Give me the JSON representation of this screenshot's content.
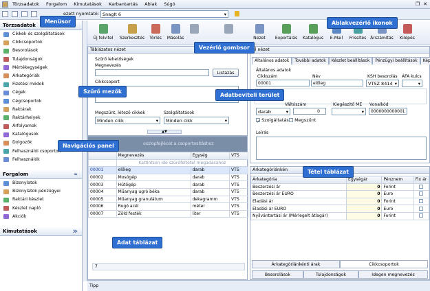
{
  "menu": [
    "Törzsadatok",
    "Forgalom",
    "Kimutatások",
    "Karbantartás",
    "Ablak",
    "Súgó"
  ],
  "printer": {
    "label": "ezett nyomtató:",
    "value": "SnagIt 6"
  },
  "sidebar": {
    "section1": "Törzsadatok",
    "items1": [
      "Cikkek és szolgáltatások",
      "Cikkcsoportok",
      "Besorolások",
      "Tulajdonságok",
      "Mértékegységek",
      "Árkategóriák",
      "Fizetési módok",
      "Cégek",
      "Cégcsoportok",
      "Raktárak",
      "Raktárhelyek",
      "Árfolyamok",
      "Katalógusok",
      "Dolgozók",
      "Felhasználói csoportok",
      "Felhasználók"
    ],
    "section2": "Forgalom",
    "items2": [
      "Bizonylatok",
      "Bizonylatok pénzügyei",
      "Raktári készlet",
      "Készlet napló",
      "Akciók"
    ],
    "section3": "Kimutatások"
  },
  "toolbar": [
    "Új felvitel",
    "Szerkesztés",
    "Törlés",
    "Másolás",
    "",
    "",
    "Nézet",
    "Exportálás",
    "Katalógus",
    "E-Mail",
    "Frissítés",
    "Árszámítás",
    "Kilépés"
  ],
  "filter": {
    "title": "Táblázatos nézet",
    "group": "Szűrő lehetőségek",
    "name_label": "Megnevezés",
    "list_button": "Listázás",
    "group_label": "Cikkcsoport",
    "state_label": "Megszűnt, létező cikkek",
    "state_value": "Minden cikk",
    "service_label": "Szolgáltatások",
    "service_value": "Minden cikk",
    "group_by": "oszlopfejlécet a csoportosításhoz",
    "filter_hint": "Kattintson ide szűrőfeltétel megadásához"
  },
  "table": {
    "headers": [
      "",
      "Megnevezés",
      "Egység",
      "VTS"
    ],
    "rows": [
      [
        "00001",
        "előleg",
        "darab",
        "VTS"
      ],
      [
        "00002",
        "Mosógép",
        "darab",
        "VTS"
      ],
      [
        "00003",
        "Hűtőgép",
        "darab",
        "VTS"
      ],
      [
        "00004",
        "Műanyag ugró béka",
        "darab",
        "VTS"
      ],
      [
        "00005",
        "Műanyag granulátum",
        "dekagramm",
        "VTS"
      ],
      [
        "00006",
        "Rugó acél",
        "méter",
        "VTS"
      ],
      [
        "00007",
        "Zöld festék",
        "liter",
        "VTS"
      ]
    ],
    "count": "7"
  },
  "detail": {
    "title": "el nézet",
    "tabs": [
      "Általános adatok",
      "További adatok",
      "Készlet beállítások",
      "Pénzügyi beállítások",
      "Kép"
    ],
    "section": "Általános adatok",
    "code_label": "Cikkszám",
    "code_value": "00001",
    "name_label": "Név",
    "name_value": "előleg",
    "ksh_label": "KSH besorolás",
    "ksh_value": "VTSZ 8414",
    "afa_label": "ÁFA kulcs",
    "unit_value": "darab",
    "exchange_label": "Váltószám",
    "exchange_value": "0",
    "extra_unit_label": "Kiegészítő ME",
    "barcode_label": "Vonalkód",
    "barcode_value": "0000000000001",
    "service_cb": "Szolgáltatás",
    "ceased_cb": "Megszűnt",
    "desc_label": "Leírás"
  },
  "prices": {
    "title": "Árkategóriánkén",
    "headers": [
      "Árkategória",
      "Egységár",
      "Pénznem",
      "Fix ár"
    ],
    "rows": [
      [
        "Beszerzési ár",
        "0",
        "Forint"
      ],
      [
        "Beszerzési ár EURO",
        "0",
        "Euro"
      ],
      [
        "Eladási ár",
        "0",
        "Forint"
      ],
      [
        "Eladási ár EURO",
        "0",
        "Euro"
      ],
      [
        "Nyilvántartási ár (Mérlegelt átlagár)",
        "0",
        "Forint"
      ]
    ],
    "tabs": [
      "Árkategóriánkénti árak",
      "Cikkcsoportok"
    ],
    "bottom_tabs": [
      "Besorolások",
      "Tulajdonságok",
      "Idegen megnevezés"
    ]
  },
  "status": "Tipp",
  "callouts": {
    "menubar": "Menüsor",
    "window_icons": "Ablakvezérlő ikonok",
    "buttons": "Vezérlő gombsor",
    "filter": "Szűrő mezők",
    "entry": "Adatbeviteli terület",
    "nav": "Navigációs panel",
    "items": "Tétel táblázat",
    "data": "Adat táblázat"
  }
}
